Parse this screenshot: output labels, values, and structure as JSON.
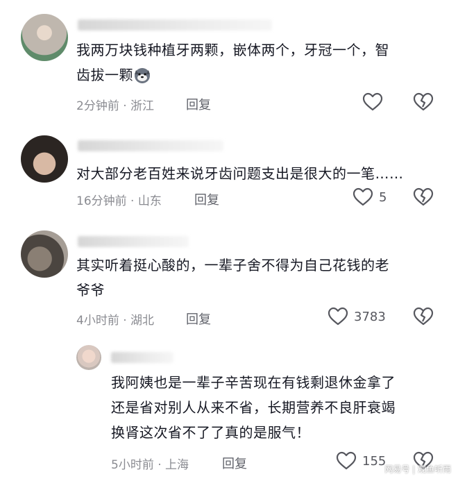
{
  "comments": [
    {
      "text_line1": "我两万块钱种植牙两颗，嵌体两个，牙冠一个，智",
      "text_line2": "齿拔一颗",
      "emoji_icon": "dog-face-emoji",
      "time": "2分钟前",
      "location": "浙江",
      "separator": "·",
      "reply": "回复",
      "likes": ""
    },
    {
      "text_line1": "对大部分老百姓来说牙齿问题支出是很大的一笔……",
      "time": "16分钟前",
      "location": "山东",
      "separator": "·",
      "reply": "回复",
      "likes": "5"
    },
    {
      "text_line1": "其实听着挺心酸的，一辈子舍不得为自己花钱的老",
      "text_line2": "爷爷",
      "time": "4小时前",
      "location": "湖北",
      "separator": "·",
      "reply": "回复",
      "likes": "3783"
    },
    {
      "text_line1": "我阿姨也是一辈子辛苦现在有钱剩退休金拿了",
      "text_line2": "还是省对别人从来不省，长期营养不良肝衰竭",
      "text_line3": "换肾这次省不了了真的是服气！",
      "time": "5小时前",
      "location": "上海",
      "separator": "·",
      "reply": "回复",
      "likes": "155"
    }
  ],
  "watermark": "网易号 | 观鱼听雨",
  "icons": {
    "like": "heart-outline-icon",
    "dislike": "broken-heart-outline-icon"
  },
  "colors": {
    "text": "#161823",
    "meta": "#8a8b91",
    "icon": "#56575e"
  }
}
